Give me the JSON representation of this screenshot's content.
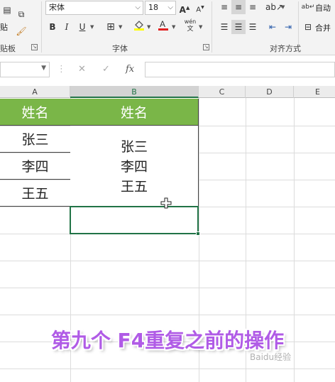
{
  "ribbon": {
    "clipboard": {
      "paste_partial": "贴",
      "label": "贴板"
    },
    "font": {
      "font_name": "宋体",
      "font_size": "18",
      "grow_font": "A",
      "shrink_font": "A",
      "bold": "B",
      "italic": "I",
      "underline": "U",
      "phonetic": "wén",
      "label": "字体"
    },
    "alignment": {
      "wrap_text_partial": "自动",
      "merge_partial": "合并",
      "label": "对齐方式"
    },
    "colors": {
      "fill": "#ffff00",
      "font": "#e02020"
    }
  },
  "formula_bar": {
    "cancel": "✕",
    "enter": "✓",
    "fx": "fx"
  },
  "columns": [
    "A",
    "B",
    "C",
    "D",
    "E"
  ],
  "table": {
    "header_a": "姓名",
    "header_b": "姓名",
    "names_a": [
      "张三",
      "李四",
      "王五"
    ],
    "merged_b": [
      "张三",
      "李四",
      "王五"
    ],
    "header_color": "#7ab648"
  },
  "caption": "第九个 F4重复之前的操作",
  "watermark": "Baidu经验",
  "accent": "#217346"
}
